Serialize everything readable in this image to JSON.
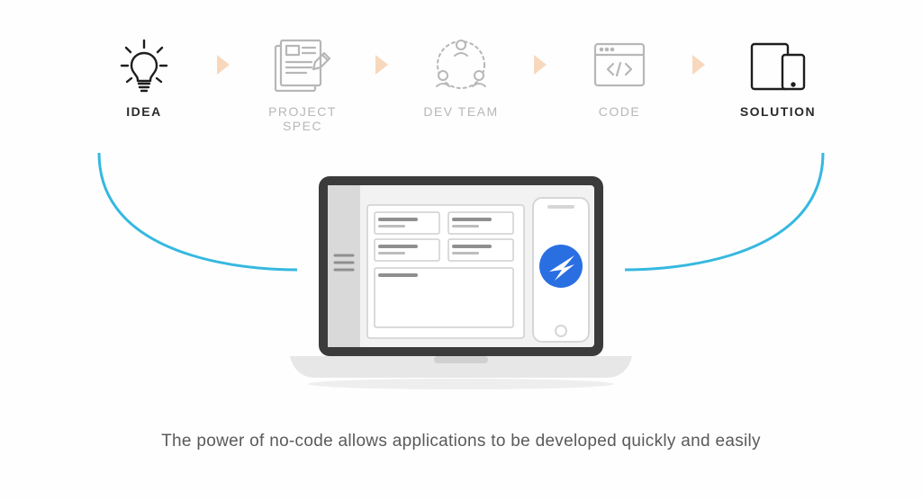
{
  "steps": [
    {
      "label": "IDEA",
      "strong": true
    },
    {
      "label": "PROJECT SPEC",
      "strong": false
    },
    {
      "label": "DEV TEAM",
      "strong": false
    },
    {
      "label": "CODE",
      "strong": false
    },
    {
      "label": "SOLUTION",
      "strong": true
    }
  ],
  "caption": "The power of no-code allows applications to be developed quickly and easily",
  "colors": {
    "chevron": "#f8d8bd",
    "connector": "#36b8e0",
    "iconMuted": "#b7b7b7",
    "iconStrong": "#1e1e1e",
    "appBlue": "#2a6fe2"
  }
}
